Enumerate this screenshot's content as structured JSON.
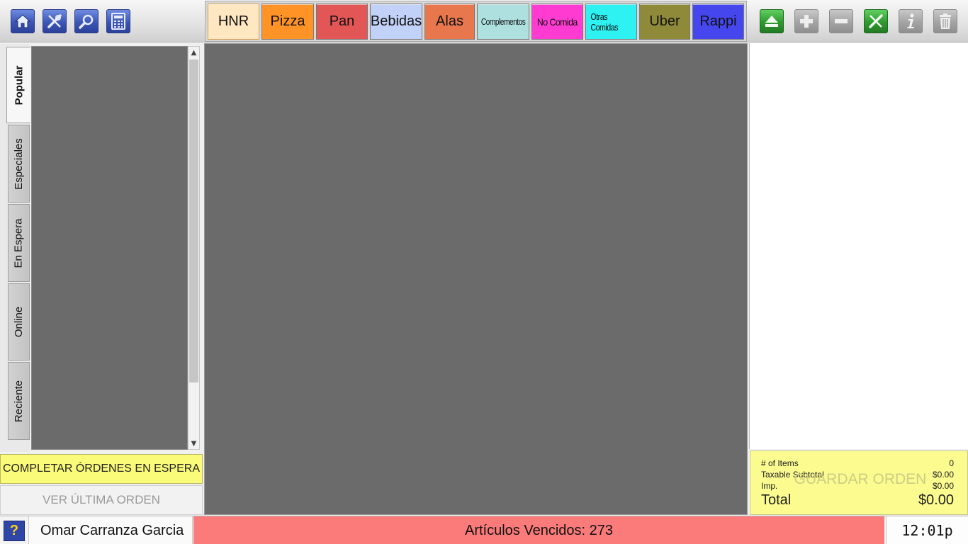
{
  "toolbar_left": {
    "icons": [
      "home-icon",
      "tools-icon",
      "search-icon",
      "calculator-icon"
    ]
  },
  "categories": [
    {
      "label": "HNR",
      "color": "#ffe7c2",
      "active": true
    },
    {
      "label": "Pizza",
      "color": "#ff9326"
    },
    {
      "label": "Pan",
      "color": "#e25656"
    },
    {
      "label": "Bebidas",
      "color": "#c2d1f7"
    },
    {
      "label": "Alas",
      "color": "#e8774e"
    },
    {
      "label": "Complementos",
      "color": "#aee0e0"
    },
    {
      "label": "No Comida",
      "color": "#ff3bd2"
    },
    {
      "label": "Otras Comidas",
      "color": "#2ef2f2"
    },
    {
      "label": "Uber",
      "color": "#8f8a3a"
    },
    {
      "label": "Rappi",
      "color": "#4646ee"
    }
  ],
  "toolbar_right": {
    "icons": [
      "eject-icon",
      "plus-icon",
      "minus-icon",
      "tools-icon",
      "info-icon",
      "trash-icon"
    ]
  },
  "side_tabs": [
    {
      "label": "Popular",
      "active": true
    },
    {
      "label": "Especiales"
    },
    {
      "label": "En Espera"
    },
    {
      "label": "Online"
    },
    {
      "label": "Reciente"
    }
  ],
  "left_buttons": {
    "complete_held": "COMPLETAR ÓRDENES EN ESPERA",
    "view_last": "VER ÚLTIMA ORDEN"
  },
  "totals": {
    "items_label": "# of Items",
    "items_value": "0",
    "subtotal_label": "Taxable Subtotal",
    "subtotal_value": "$0.00",
    "tax_label": "Imp.",
    "tax_value": "$0.00",
    "total_label": "Total",
    "total_value": "$0.00",
    "save_label": "GUARDAR ORDEN"
  },
  "status_bar": {
    "help_glyph": "?",
    "user_name": "Omar Carranza Garcia",
    "expired_items": "Artículos Vencidos: 273",
    "clock": "12:01p"
  }
}
